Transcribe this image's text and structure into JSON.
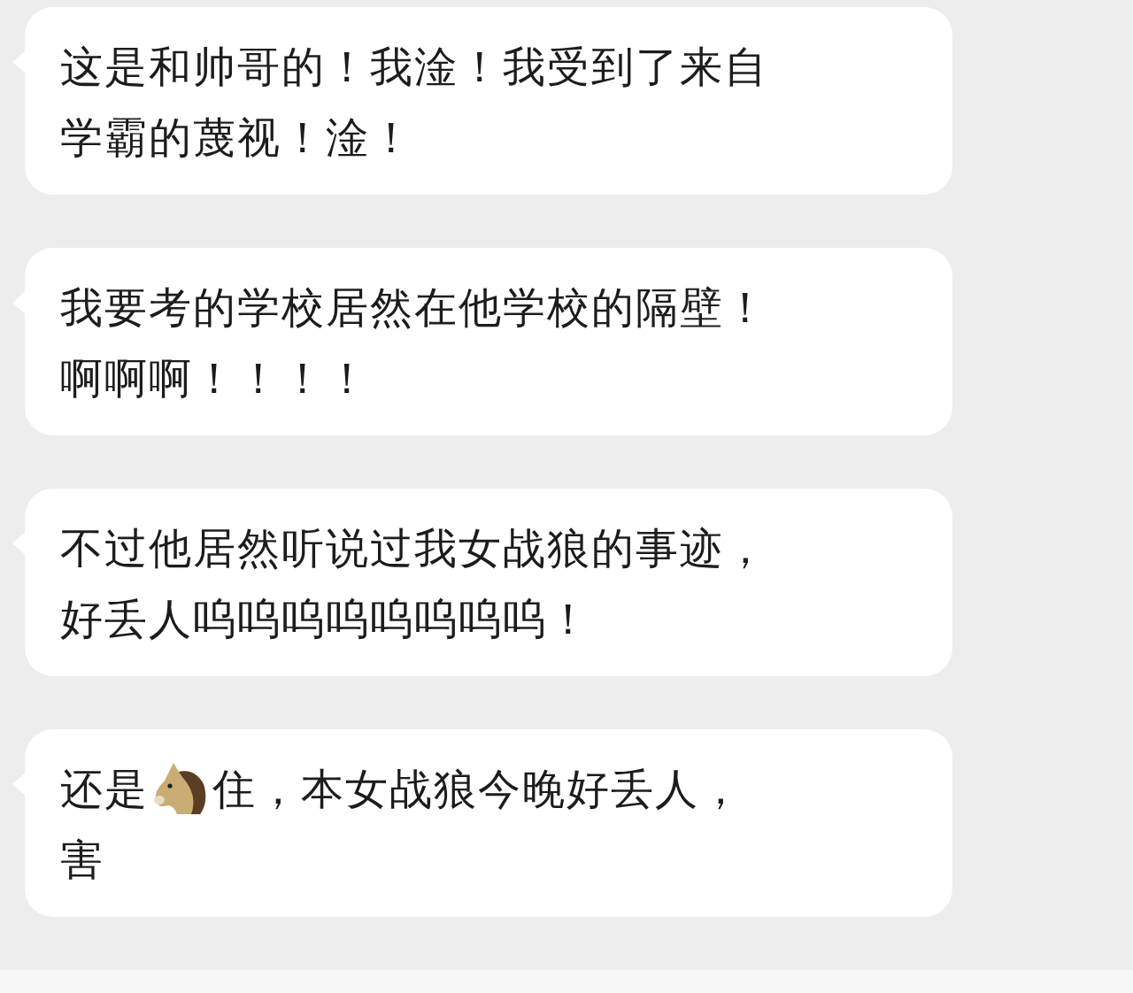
{
  "messages": [
    {
      "lines": [
        [
          {
            "kind": "text",
            "text": "这是和帅哥的！我淦！我受到了来自"
          }
        ],
        [
          {
            "kind": "text",
            "text": "学霸的蔑视！淦！"
          }
        ]
      ]
    },
    {
      "lines": [
        [
          {
            "kind": "text",
            "text": "我要考的学校居然在他学校的隔壁！"
          }
        ],
        [
          {
            "kind": "text",
            "text": "啊啊啊！！！！"
          }
        ]
      ]
    },
    {
      "lines": [
        [
          {
            "kind": "text",
            "text": "不过他居然听说过我女战狼的事迹，"
          }
        ],
        [
          {
            "kind": "text",
            "text": "好丢人呜呜呜呜呜呜呜呜！"
          }
        ]
      ]
    },
    {
      "lines": [
        [
          {
            "kind": "text",
            "text": "还是"
          },
          {
            "kind": "icon"
          },
          {
            "kind": "text",
            "text": "住，本女战狼今晚好丢人，"
          }
        ],
        [
          {
            "kind": "text",
            "text": "害"
          }
        ]
      ]
    }
  ]
}
